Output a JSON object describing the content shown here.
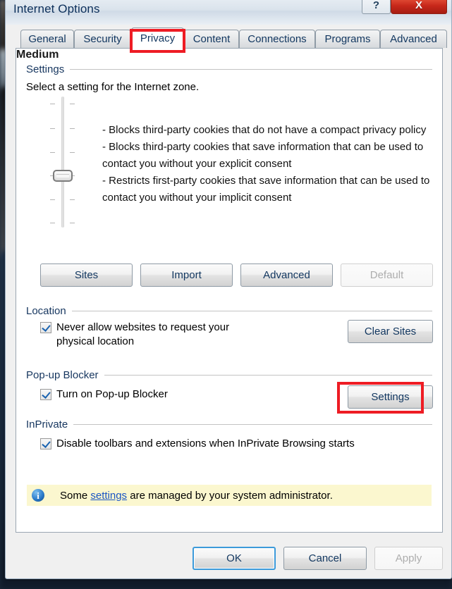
{
  "window": {
    "title": "Internet Options",
    "help_label": "?",
    "close_label": "X"
  },
  "tabs": [
    {
      "label": "General",
      "active": false
    },
    {
      "label": "Security",
      "active": false
    },
    {
      "label": "Privacy",
      "active": true
    },
    {
      "label": "Content",
      "active": false
    },
    {
      "label": "Connections",
      "active": false
    },
    {
      "label": "Programs",
      "active": false
    },
    {
      "label": "Advanced",
      "active": false
    }
  ],
  "settings_group": {
    "title": "Settings",
    "zone_prompt": "Select a setting for the Internet zone.",
    "level_name": "Medium",
    "level_description": "- Blocks third-party cookies that do not have a compact privacy policy\n- Blocks third-party cookies that save information that can be used to contact you without your explicit consent\n- Restricts first-party cookies that save information that can be used to contact you without your implicit consent",
    "slider": {
      "positions": 6,
      "selected_index": 4
    },
    "buttons": [
      {
        "label": "Sites",
        "disabled": false
      },
      {
        "label": "Import",
        "disabled": false
      },
      {
        "label": "Advanced",
        "disabled": false
      },
      {
        "label": "Default",
        "disabled": true
      }
    ]
  },
  "location_group": {
    "title": "Location",
    "checkbox_label": "Never allow websites to request your\nphysical location",
    "checkbox_checked": true,
    "button_label": "Clear Sites"
  },
  "popup_group": {
    "title": "Pop-up Blocker",
    "checkbox_label": "Turn on Pop-up Blocker",
    "checkbox_checked": true,
    "button_label": "Settings"
  },
  "inprivate_group": {
    "title": "InPrivate",
    "checkbox_label": "Disable toolbars and extensions when InPrivate Browsing starts",
    "checkbox_checked": true
  },
  "info_bar": {
    "icon": "info-icon",
    "text_before": "Some ",
    "link_text": "settings",
    "text_after": " are managed by your system administrator."
  },
  "footer": {
    "ok_label": "OK",
    "cancel_label": "Cancel",
    "apply_label": "Apply",
    "apply_disabled": true
  },
  "annotations": {
    "highlight_color": "#ee1c24",
    "targets": [
      "tab-privacy",
      "popup-settings-button"
    ]
  }
}
